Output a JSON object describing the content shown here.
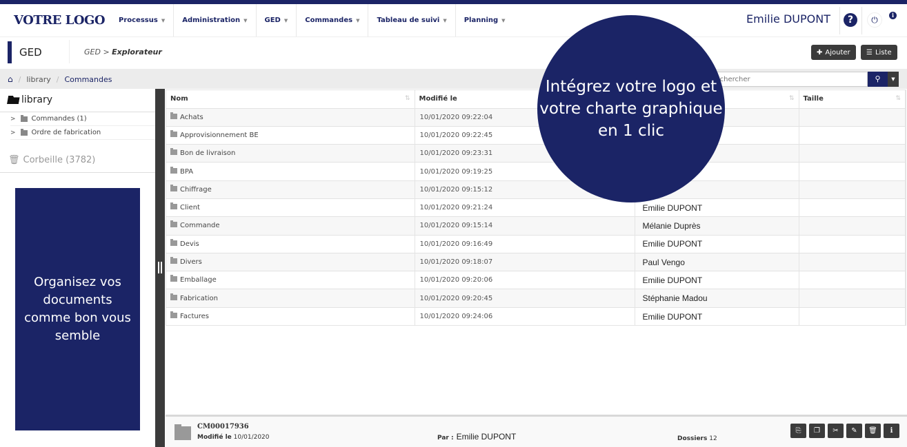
{
  "brand": {
    "logo": "VOTRE LOGO",
    "accent": "#1b2466",
    "dark": "#3b3b3b"
  },
  "nav": {
    "menu": [
      {
        "label": "Processus"
      },
      {
        "label": "Administration"
      },
      {
        "label": "GED"
      },
      {
        "label": "Commandes"
      },
      {
        "label": "Tableau de suivi"
      },
      {
        "label": "Planning"
      }
    ],
    "user_name": "Emilie DUPONT",
    "help_icon": "?",
    "power_icon": "⏻",
    "info_icon": "i"
  },
  "subheader": {
    "module": "GED",
    "path_prefix": "GED >",
    "path_current": "Explorateur",
    "add_label": "Ajouter",
    "list_label": "Liste"
  },
  "breadcrumb": {
    "items": [
      "library",
      "Commandes"
    ]
  },
  "search": {
    "placeholder": "Rechercher"
  },
  "sidebar": {
    "root": "library",
    "tree": [
      {
        "label": "Commandes (1)"
      },
      {
        "label": "Ordre de fabrication"
      }
    ],
    "trash": "Corbeille (3782)",
    "promo": "Organisez vos documents comme bon vous semble"
  },
  "table": {
    "columns": [
      "Nom",
      "Modifié le",
      "",
      "Taille"
    ],
    "rows": [
      {
        "name": "Achats",
        "modified": "10/01/2020 09:22:04",
        "author": "",
        "size": ""
      },
      {
        "name": "Approvisionnement BE",
        "modified": "10/01/2020 09:22:45",
        "author": "",
        "size": ""
      },
      {
        "name": "Bon de livraison",
        "modified": "10/01/2020 09:23:31",
        "author": "",
        "size": ""
      },
      {
        "name": "BPA",
        "modified": "10/01/2020 09:19:25",
        "author": "",
        "size": ""
      },
      {
        "name": "Chiffrage",
        "modified": "10/01/2020 09:15:12",
        "author": "",
        "size": ""
      },
      {
        "name": "Client",
        "modified": "10/01/2020 09:21:24",
        "author": "Emilie DUPONT",
        "size": ""
      },
      {
        "name": "Commande",
        "modified": "10/01/2020 09:15:14",
        "author": "Mélanie Duprès",
        "size": ""
      },
      {
        "name": "Devis",
        "modified": "10/01/2020 09:16:49",
        "author": "Emilie DUPONT",
        "size": ""
      },
      {
        "name": "Divers",
        "modified": "10/01/2020 09:18:07",
        "author": "Paul Vengo",
        "size": ""
      },
      {
        "name": "Emballage",
        "modified": "10/01/2020 09:20:06",
        "author": "Emilie DUPONT",
        "size": ""
      },
      {
        "name": "Fabrication",
        "modified": "10/01/2020 09:20:45",
        "author": "Stéphanie Madou",
        "size": ""
      },
      {
        "name": "Factures",
        "modified": "10/01/2020 09:24:06",
        "author": "Emilie DUPONT",
        "size": ""
      }
    ]
  },
  "promo_circle": "Intégrez votre logo et votre charte graphique en 1 clic",
  "details": {
    "code": "CM00017936",
    "modified_label": "Modifié le",
    "modified_value": "10/01/2020",
    "by_label": "Par :",
    "by_value": "Emilie DUPONT",
    "folders_label": "Dossiers",
    "folders_value": "12",
    "actions": [
      {
        "name": "export",
        "glyph": "⎘"
      },
      {
        "name": "copy",
        "glyph": "❐"
      },
      {
        "name": "cut",
        "glyph": "✂"
      },
      {
        "name": "edit",
        "glyph": "✎"
      },
      {
        "name": "delete",
        "glyph": "🗑"
      },
      {
        "name": "info",
        "glyph": "i"
      }
    ]
  }
}
